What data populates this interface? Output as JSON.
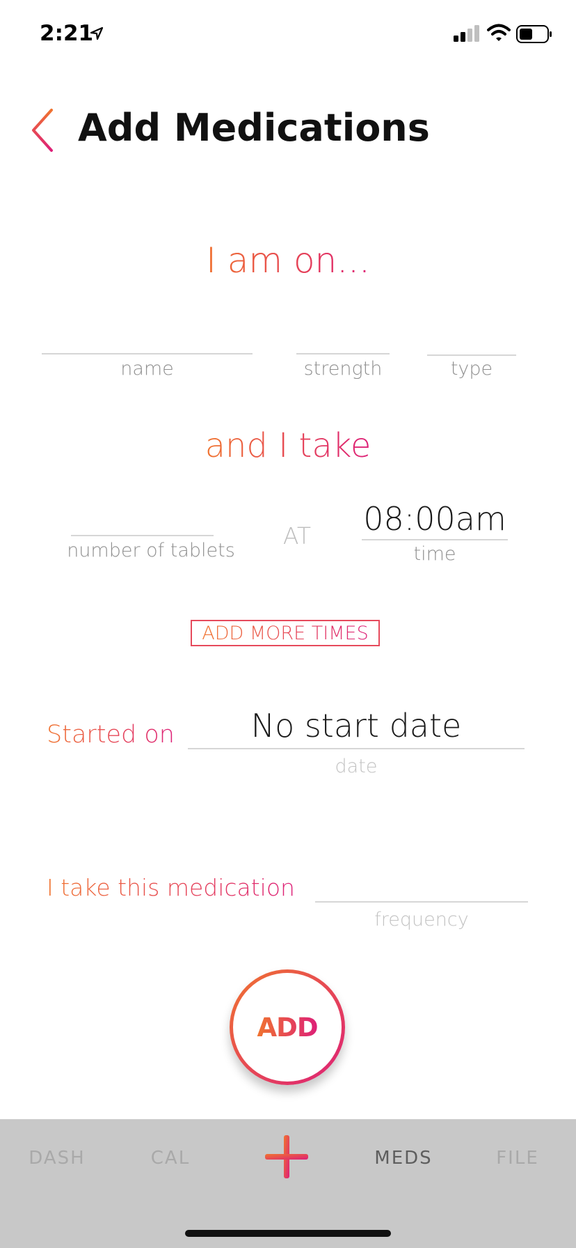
{
  "status_bar": {
    "time": "2:21"
  },
  "header": {
    "title": "Add Medications"
  },
  "form": {
    "heading": "I am on...",
    "name_label": "name",
    "strength_label": "strength",
    "type_label": "type",
    "subheading": "and I take",
    "tablets_label": "number of tablets",
    "at_label": "AT",
    "time_value": "08:00am",
    "time_label": "time",
    "add_more_times": "ADD MORE TIMES",
    "started_on_label": "Started on",
    "start_date_value": "No start date",
    "date_label": "date",
    "frequency_prefix": "I take this medication",
    "frequency_label": "frequency",
    "add_button": "ADD"
  },
  "tabbar": {
    "items": [
      {
        "label": "DASH",
        "active": false
      },
      {
        "label": "CAL",
        "active": false
      },
      {
        "label": "MEDS",
        "active": true
      },
      {
        "label": "FILE",
        "active": false
      }
    ]
  },
  "colors": {
    "accent_start": "#f0742f",
    "accent_end": "#dd1f78",
    "tabbar_bg": "#c8c8c8"
  }
}
